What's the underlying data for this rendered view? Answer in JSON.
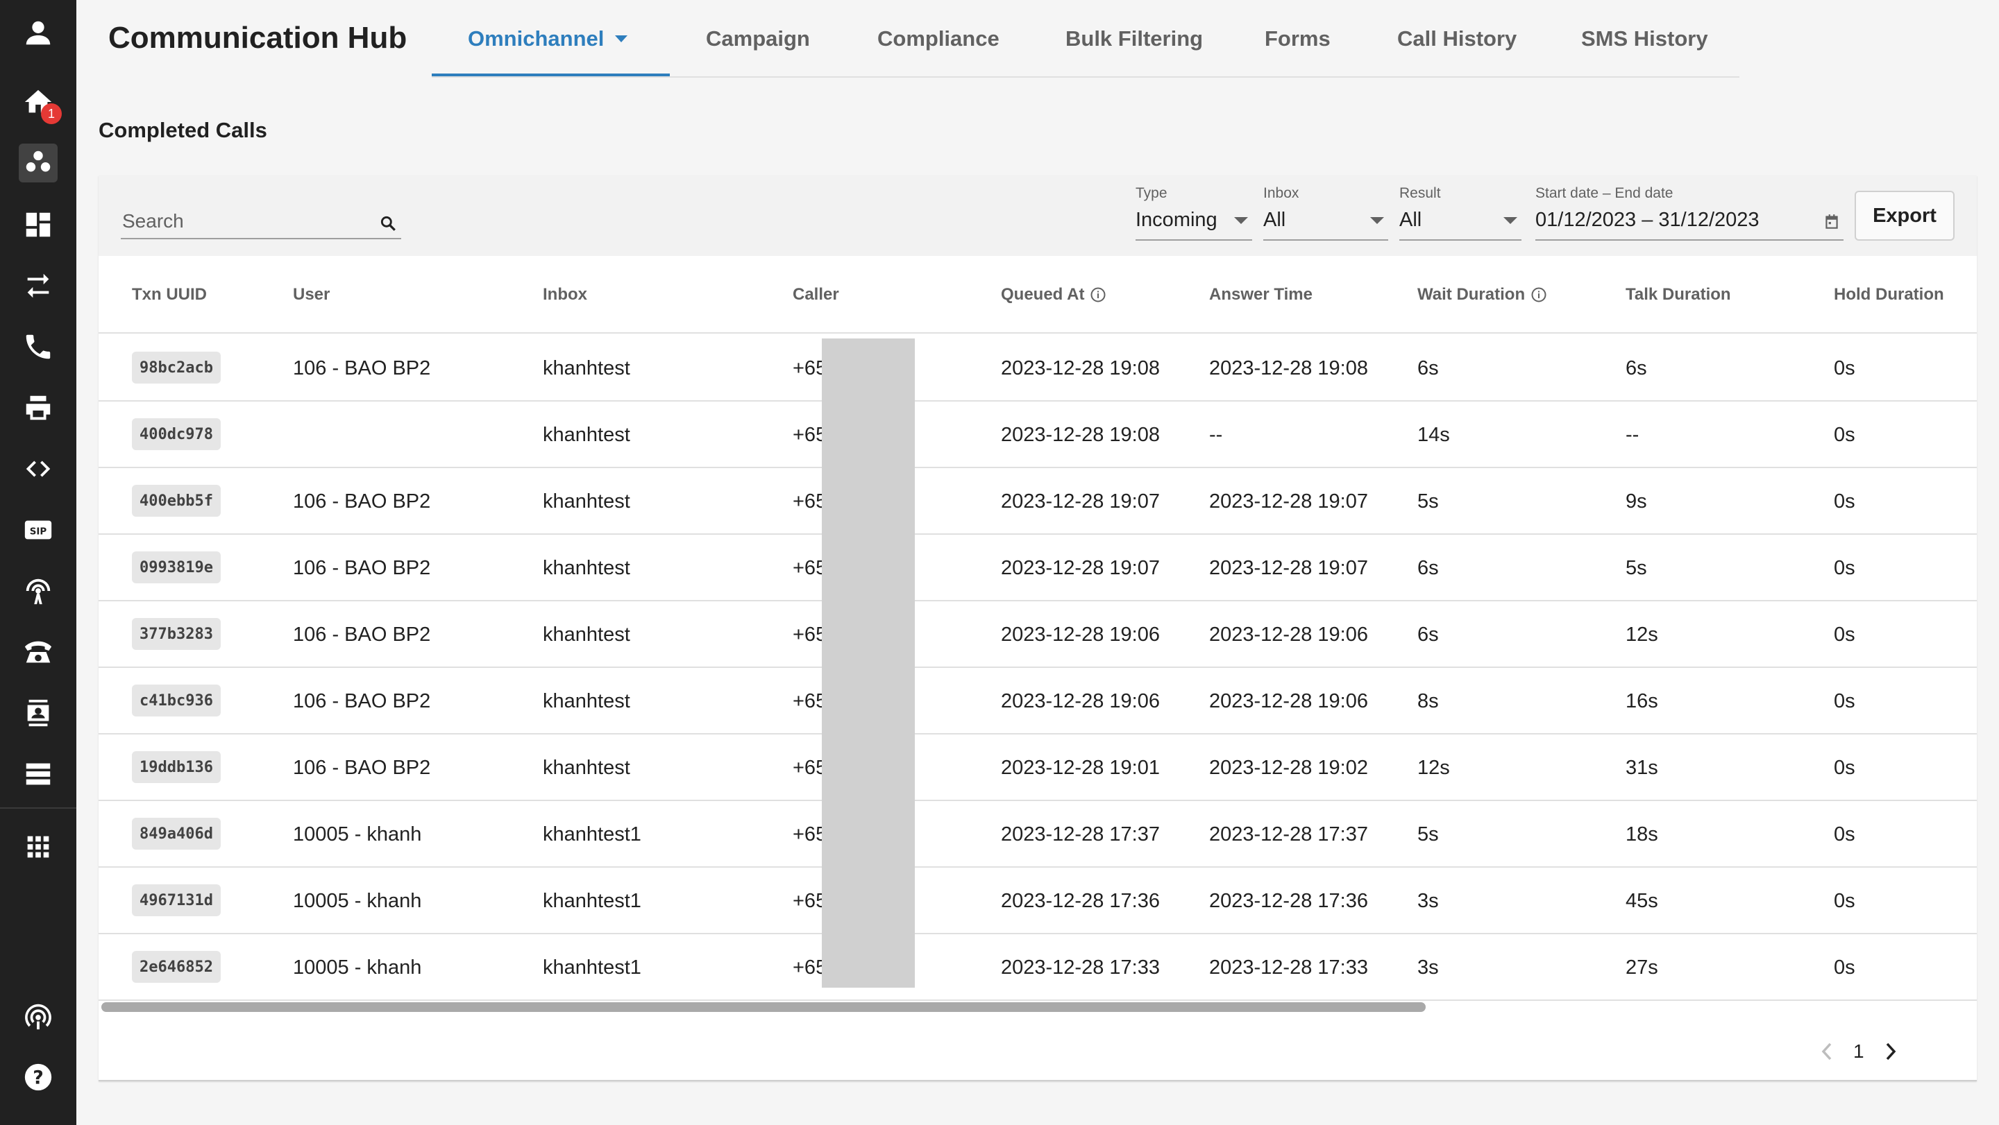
{
  "app": {
    "title": "Communication Hub"
  },
  "sidebar": {
    "home_badge": "1",
    "items": [
      "user-icon",
      "home-icon",
      "group-icon",
      "dashboard-icon",
      "transfer-icon",
      "phone-icon",
      "printer-icon",
      "code-icon",
      "sip-icon",
      "antenna-icon",
      "desk-phone-icon",
      "contact-card-icon",
      "list-icon",
      "grid-icon",
      "broadcast-icon",
      "help-icon"
    ]
  },
  "tabs": [
    {
      "label": "Omnichannel",
      "active": true
    },
    {
      "label": "Campaign"
    },
    {
      "label": "Compliance"
    },
    {
      "label": "Bulk Filtering"
    },
    {
      "label": "Forms"
    },
    {
      "label": "Call History"
    },
    {
      "label": "SMS History"
    }
  ],
  "section_title": "Completed Calls",
  "filters": {
    "search_placeholder": "Search",
    "type": {
      "label": "Type",
      "value": "Incoming"
    },
    "inbox": {
      "label": "Inbox",
      "value": "All"
    },
    "result": {
      "label": "Result",
      "value": "All"
    },
    "date": {
      "label": "Start date – End date",
      "value": "01/12/2023 – 31/12/2023"
    },
    "export_label": "Export"
  },
  "table": {
    "columns": [
      "Txn UUID",
      "User",
      "Inbox",
      "Caller",
      "Queued At",
      "Answer Time",
      "Wait Duration",
      "Talk Duration",
      "Hold Duration"
    ],
    "rows": [
      {
        "uuid": "98bc2acb",
        "user": "106 - BAO BP2",
        "inbox": "khanhtest",
        "caller": "+65",
        "queued": "2023-12-28 19:08",
        "answer": "2023-12-28 19:08",
        "wait": "6s",
        "talk": "6s",
        "hold": "0s"
      },
      {
        "uuid": "400dc978",
        "user": "",
        "inbox": "khanhtest",
        "caller": "+65",
        "queued": "2023-12-28 19:08",
        "answer": "--",
        "wait": "14s",
        "talk": "--",
        "hold": "0s"
      },
      {
        "uuid": "400ebb5f",
        "user": "106 - BAO BP2",
        "inbox": "khanhtest",
        "caller": "+65",
        "queued": "2023-12-28 19:07",
        "answer": "2023-12-28 19:07",
        "wait": "5s",
        "talk": "9s",
        "hold": "0s"
      },
      {
        "uuid": "0993819e",
        "user": "106 - BAO BP2",
        "inbox": "khanhtest",
        "caller": "+65",
        "queued": "2023-12-28 19:07",
        "answer": "2023-12-28 19:07",
        "wait": "6s",
        "talk": "5s",
        "hold": "0s"
      },
      {
        "uuid": "377b3283",
        "user": "106 - BAO BP2",
        "inbox": "khanhtest",
        "caller": "+65",
        "queued": "2023-12-28 19:06",
        "answer": "2023-12-28 19:06",
        "wait": "6s",
        "talk": "12s",
        "hold": "0s"
      },
      {
        "uuid": "c41bc936",
        "user": "106 - BAO BP2",
        "inbox": "khanhtest",
        "caller": "+65",
        "queued": "2023-12-28 19:06",
        "answer": "2023-12-28 19:06",
        "wait": "8s",
        "talk": "16s",
        "hold": "0s"
      },
      {
        "uuid": "19ddb136",
        "user": "106 - BAO BP2",
        "inbox": "khanhtest",
        "caller": "+65",
        "queued": "2023-12-28 19:01",
        "answer": "2023-12-28 19:02",
        "wait": "12s",
        "talk": "31s",
        "hold": "0s"
      },
      {
        "uuid": "849a406d",
        "user": "10005 - khanh",
        "inbox": "khanhtest1",
        "caller": "+65",
        "queued": "2023-12-28 17:37",
        "answer": "2023-12-28 17:37",
        "wait": "5s",
        "talk": "18s",
        "hold": "0s"
      },
      {
        "uuid": "4967131d",
        "user": "10005 - khanh",
        "inbox": "khanhtest1",
        "caller": "+65",
        "queued": "2023-12-28 17:36",
        "answer": "2023-12-28 17:36",
        "wait": "3s",
        "talk": "45s",
        "hold": "0s"
      },
      {
        "uuid": "2e646852",
        "user": "10005 - khanh",
        "inbox": "khanhtest1",
        "caller": "+65",
        "queued": "2023-12-28 17:33",
        "answer": "2023-12-28 17:33",
        "wait": "3s",
        "talk": "27s",
        "hold": "0s"
      }
    ]
  },
  "pagination": {
    "current_page": "1"
  },
  "colors": {
    "accent": "#2e7ebd",
    "sidebar_bg": "#212121",
    "badge": "#e53935"
  }
}
